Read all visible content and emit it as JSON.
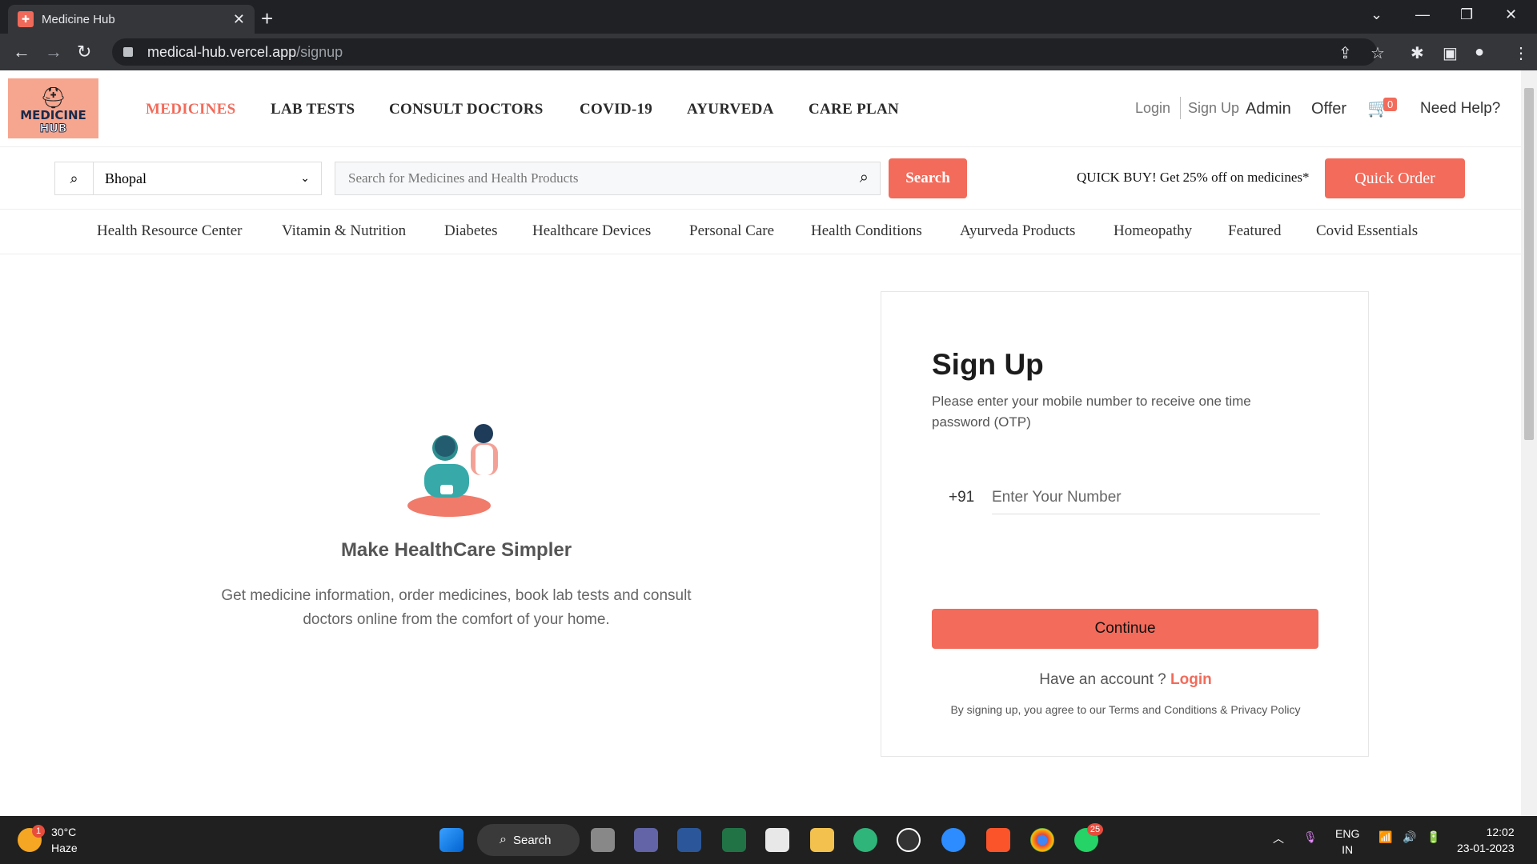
{
  "browser": {
    "tab_title": "Medicine Hub",
    "url_host": "medical-hub.vercel.app",
    "url_path": "/signup"
  },
  "logo": {
    "line1": "MEDICINE",
    "line2": "HUB"
  },
  "main_nav": [
    "MEDICINES",
    "LAB TESTS",
    "CONSULT DOCTORS",
    "COVID-19",
    "AYURVEDA",
    "CARE PLAN"
  ],
  "header_right": {
    "login": "Login",
    "signup": "Sign Up",
    "admin": "Admin",
    "offer": "Offer",
    "cart_count": "0",
    "help": "Need Help?"
  },
  "search": {
    "city": "Bhopal",
    "placeholder": "Search for Medicines and Health Products",
    "button": "Search",
    "promo": "QUICK BUY! Get 25% off on medicines*",
    "quick_order": "Quick Order"
  },
  "categories": [
    "Health Resource Center",
    "Vitamin & Nutrition",
    "Diabetes",
    "Healthcare Devices",
    "Personal Care",
    "Health Conditions",
    "Ayurveda Products",
    "Homeopathy",
    "Featured",
    "Covid Essentials"
  ],
  "left_panel": {
    "title": "Make HealthCare Simpler",
    "description": "Get medicine information, order medicines, book lab tests and consult doctors online from the comfort of your home."
  },
  "signup": {
    "title": "Sign Up",
    "subtitle": "Please enter your mobile number to receive one time password (OTP)",
    "country_code": "+91",
    "phone_placeholder": "Enter Your Number",
    "continue": "Continue",
    "have_account": "Have an account ? ",
    "login_link": "Login",
    "terms": "By signing up, you agree to our Terms and Conditions & Privacy Policy"
  },
  "taskbar": {
    "temp": "30°C",
    "weather": "Haze",
    "weather_badge": "1",
    "search": "Search",
    "whatsapp_badge": "25",
    "lang1": "ENG",
    "lang2": "IN",
    "time": "12:02",
    "date": "23-01-2023"
  },
  "colors": {
    "accent": "#f26b5b",
    "chrome_dark": "#202124",
    "taskbar": "#202020"
  }
}
